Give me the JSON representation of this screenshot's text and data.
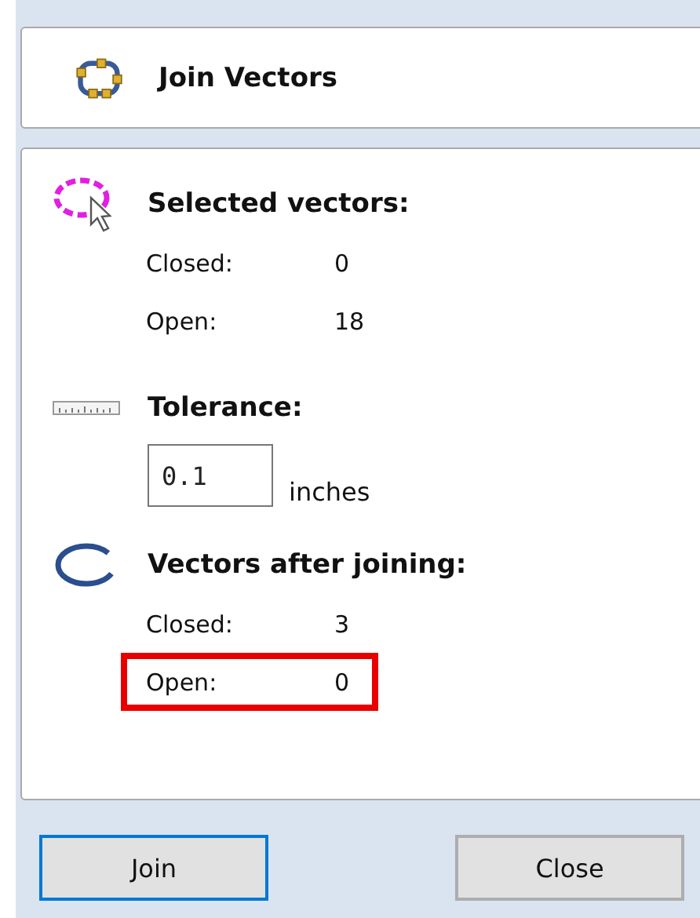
{
  "title": {
    "text": "Join Vectors"
  },
  "sections": [
    {
      "kind": "counts",
      "heading": "Selected vectors:",
      "rows": [
        {
          "label": "Closed:",
          "value": "0",
          "highlighted": false
        },
        {
          "label": "Open:",
          "value": "18",
          "highlighted": false
        }
      ]
    },
    {
      "kind": "tolerance",
      "heading": "Tolerance:",
      "value": "0.1",
      "unit": "inches"
    },
    {
      "kind": "counts",
      "heading": "Vectors after joining:",
      "rows": [
        {
          "label": "Closed:",
          "value": "3",
          "highlighted": false
        },
        {
          "label": "Open:",
          "value": "0",
          "highlighted": true
        }
      ]
    }
  ],
  "buttons": [
    {
      "label": "Join",
      "focused": true
    },
    {
      "label": "Close",
      "focused": false
    }
  ]
}
